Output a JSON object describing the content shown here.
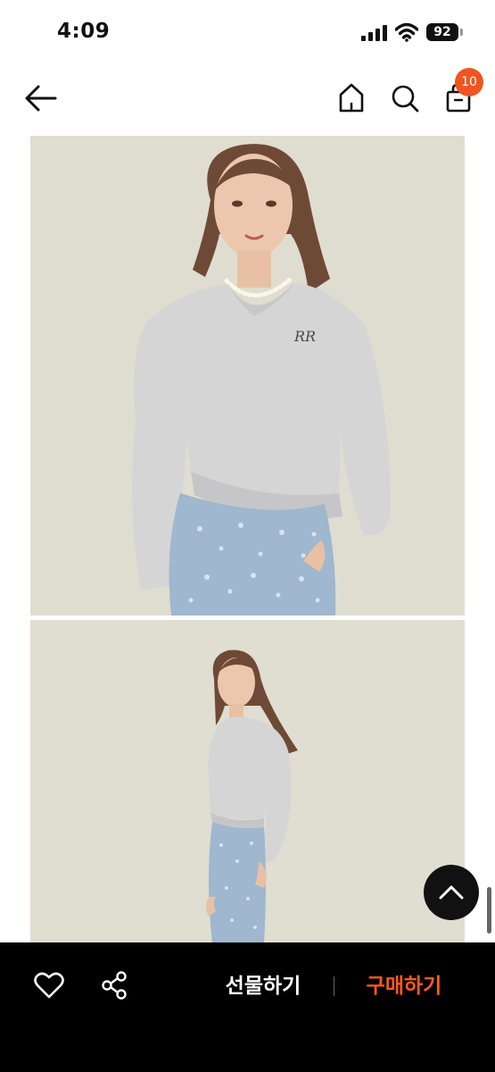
{
  "status_bar": {
    "time": "4:09",
    "battery": "92"
  },
  "header": {
    "cart_count": "10",
    "icons": [
      "back-arrow-icon",
      "home-icon",
      "search-icon",
      "cart-icon"
    ]
  },
  "gallery": {
    "images": [
      "model-front-photo",
      "model-full-body-photo"
    ],
    "background_color": "#dfddcf"
  },
  "bottom_bar": {
    "gift_label": "선물하기",
    "buy_label": "구매하기",
    "buy_color": "#ff5a1f",
    "icons": [
      "heart-icon",
      "share-icon"
    ]
  },
  "colors": {
    "badge": "#ee5521",
    "bar": "#000000"
  }
}
